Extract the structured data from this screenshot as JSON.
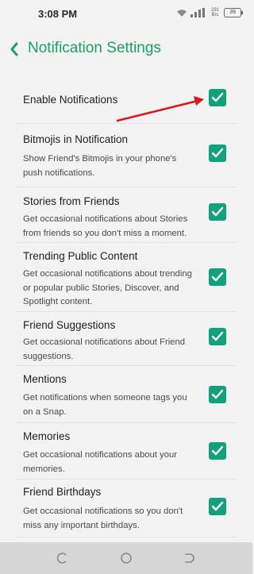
{
  "status": {
    "time": "3:08 PM",
    "speed": "291 B/s",
    "battery": "39"
  },
  "header": {
    "title": "Notification Settings"
  },
  "items": [
    {
      "title": "Enable Notifications",
      "desc": ""
    },
    {
      "title": "Bitmojis in Notification",
      "desc": "Show Friend's Bitmojis in your phone's push notifications."
    },
    {
      "title": "Stories from Friends",
      "desc": "Get occasional notifications about Stories from friends so you don't miss a moment."
    },
    {
      "title": "Trending Public Content",
      "desc": "Get occasional notifications about trending or popular public Stories, Discover, and Spotlight content."
    },
    {
      "title": "Friend Suggestions",
      "desc": "Get occasional notifications about Friend suggestions."
    },
    {
      "title": "Mentions",
      "desc": "Get notifications when someone tags you on a Snap."
    },
    {
      "title": "Memories",
      "desc": "Get occasional notifications about your memories."
    },
    {
      "title": "Friend Birthdays",
      "desc": "Get occasional notifications so you don't miss any important birthdays."
    }
  ],
  "colors": {
    "accent": "#1aa260",
    "checkbox": "#12a27b",
    "arrow": "#e0151b"
  },
  "icons": {
    "back": "chevron-left-icon",
    "check": "checkmark-icon",
    "annotation": "red-arrow-icon"
  }
}
